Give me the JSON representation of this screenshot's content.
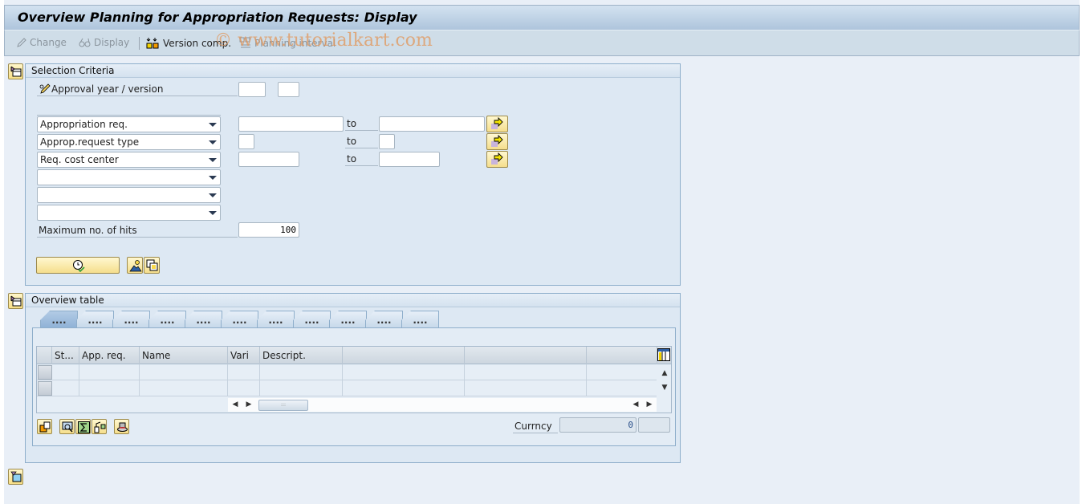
{
  "window": {
    "title": "Overview Planning for Appropriation Requests: Display"
  },
  "toolbar": {
    "change_label": "Change",
    "display_label": "Display",
    "version_comp_label": "Version comp.",
    "planning_interval_label": "Planning interval"
  },
  "watermark": "© www.tutorialkart.com",
  "selection": {
    "header": "Selection Criteria",
    "approval_label": "Approval year / version",
    "approval_year": "",
    "approval_version": "",
    "to_label": "to",
    "rows": [
      {
        "field": "Appropriation req.",
        "from": "",
        "to": ""
      },
      {
        "field": "Approp.request type",
        "from": "",
        "to": ""
      },
      {
        "field": "Req. cost center",
        "from": "",
        "to": ""
      },
      {
        "field": ""
      },
      {
        "field": ""
      },
      {
        "field": ""
      }
    ],
    "max_hits_label": "Maximum no. of hits",
    "max_hits_value": "100"
  },
  "overview": {
    "header": "Overview table",
    "tabs": [
      "....",
      "....",
      "....",
      "....",
      "....",
      "....",
      "....",
      "....",
      "....",
      "....",
      "...."
    ],
    "columns": [
      "St...",
      "App. req.",
      "Name",
      "Vari",
      "Descript.",
      "",
      "",
      ""
    ],
    "rows": [
      [
        "",
        "",
        "",
        "",
        "",
        "",
        "",
        ""
      ],
      [
        "",
        "",
        "",
        "",
        "",
        "",
        "",
        ""
      ]
    ],
    "currency_label": "Currncy",
    "currency_amount": "0",
    "currency_unit": ""
  }
}
